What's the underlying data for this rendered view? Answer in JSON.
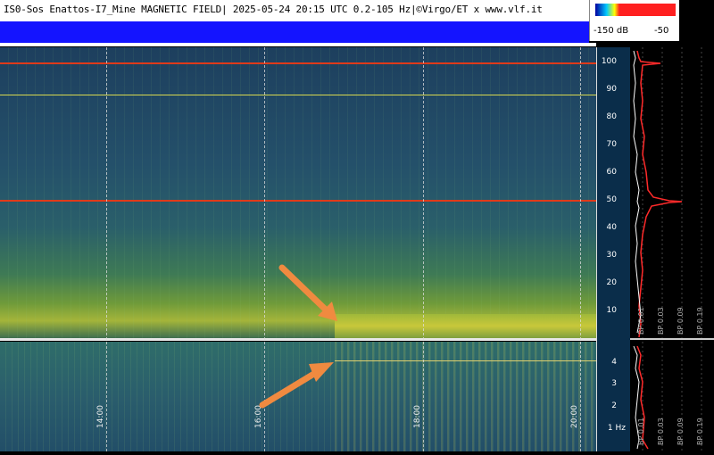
{
  "header": {
    "title": "IS0-Sos Enattos-I7_Mine MAGNETIC FIELD| 2025-05-24 20:15 UTC 0.2-105 Hz|©Virgo/ET x www.vlf.it"
  },
  "legend": {
    "low_label": "-150 dB",
    "high_label": "-50"
  },
  "time_axis": {
    "labels": [
      "14:00",
      "16:00",
      "18:00",
      "20:00"
    ]
  },
  "freq_axis_top": {
    "labels": [
      "100",
      "90",
      "80",
      "70",
      "60",
      "50",
      "40",
      "30",
      "20",
      "10"
    ]
  },
  "freq_axis_bottom": {
    "labels": [
      "4",
      "3",
      "2",
      "1 Hz"
    ]
  },
  "profile_labels": [
    "BP 0.01",
    "BP 0.03",
    "BP 0.09",
    "BP 0.19"
  ],
  "colors": {
    "background": "#000000",
    "blue_band": "#1414ff",
    "marker_red": "#e03a1a",
    "marker_yellow": "#d8d850",
    "arrow": "#f08a40"
  }
}
